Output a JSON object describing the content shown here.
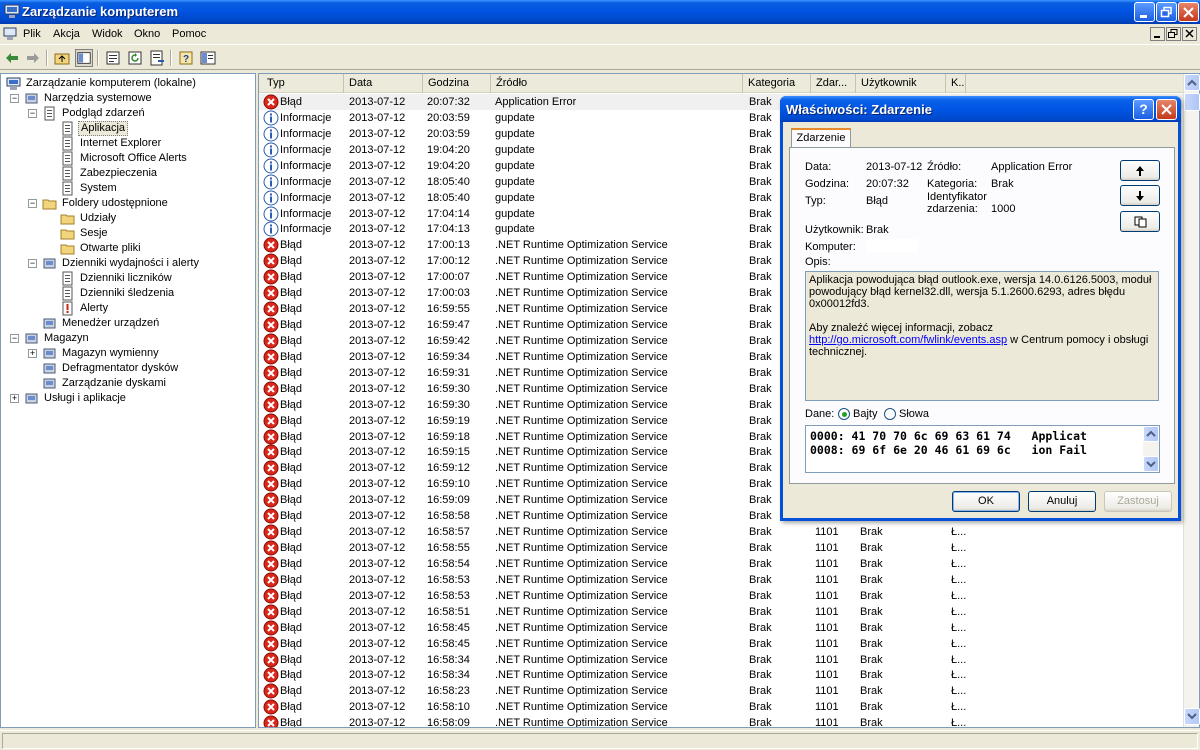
{
  "window": {
    "title": "Zarządzanie komputerem"
  },
  "menu": {
    "items": [
      "Plik",
      "Akcja",
      "Widok",
      "Okno",
      "Pomoc"
    ]
  },
  "tree": {
    "nodes": [
      {
        "label": "Zarządzanie komputerem (lokalne)",
        "icon": "computer-management-icon",
        "level": 0,
        "expander": ""
      },
      {
        "label": "Narzędzia systemowe",
        "icon": "system-tools-icon",
        "level": 1,
        "expander": "-"
      },
      {
        "label": "Podgląd zdarzeń",
        "icon": "event-viewer-icon",
        "level": 2,
        "expander": "-"
      },
      {
        "label": "Aplikacja",
        "icon": "log-icon",
        "level": 3,
        "expander": "",
        "selected": true
      },
      {
        "label": "Internet Explorer",
        "icon": "log-icon",
        "level": 3,
        "expander": ""
      },
      {
        "label": "Microsoft Office Alerts",
        "icon": "log-icon",
        "level": 3,
        "expander": ""
      },
      {
        "label": "Zabezpieczenia",
        "icon": "log-icon",
        "level": 3,
        "expander": ""
      },
      {
        "label": "System",
        "icon": "log-icon",
        "level": 3,
        "expander": ""
      },
      {
        "label": "Foldery udostępnione",
        "icon": "shared-folder-icon",
        "level": 2,
        "expander": "-"
      },
      {
        "label": "Udziały",
        "icon": "folder-icon",
        "level": 3,
        "expander": ""
      },
      {
        "label": "Sesje",
        "icon": "folder-icon",
        "level": 3,
        "expander": ""
      },
      {
        "label": "Otwarte pliki",
        "icon": "folder-icon",
        "level": 3,
        "expander": ""
      },
      {
        "label": "Dzienniki wydajności i alerty",
        "icon": "performance-icon",
        "level": 2,
        "expander": "-"
      },
      {
        "label": "Dzienniki liczników",
        "icon": "log-icon",
        "level": 3,
        "expander": ""
      },
      {
        "label": "Dzienniki śledzenia",
        "icon": "log-icon",
        "level": 3,
        "expander": ""
      },
      {
        "label": "Alerty",
        "icon": "alert-icon",
        "level": 3,
        "expander": ""
      },
      {
        "label": "Menedżer urządzeń",
        "icon": "device-manager-icon",
        "level": 2,
        "expander": ""
      },
      {
        "label": "Magazyn",
        "icon": "storage-icon",
        "level": 1,
        "expander": "-"
      },
      {
        "label": "Magazyn wymienny",
        "icon": "removable-storage-icon",
        "level": 2,
        "expander": "+"
      },
      {
        "label": "Defragmentator dysków",
        "icon": "defrag-icon",
        "level": 2,
        "expander": ""
      },
      {
        "label": "Zarządzanie dyskami",
        "icon": "disk-management-icon",
        "level": 2,
        "expander": ""
      },
      {
        "label": "Usługi i aplikacje",
        "icon": "services-icon",
        "level": 1,
        "expander": "+"
      }
    ]
  },
  "list": {
    "columns": [
      "Typ",
      "Data",
      "Godzina",
      "Źródło",
      "Kategoria",
      "Zdar...",
      "Użytkownik",
      "K..."
    ],
    "rows": [
      {
        "type": "err",
        "typ": "Błąd",
        "date": "2013-07-12",
        "time": "20:07:32",
        "source": "Application Error",
        "cat": "Brak",
        "ev": "",
        "user": "",
        "k": ""
      },
      {
        "type": "inf",
        "typ": "Informacje",
        "date": "2013-07-12",
        "time": "20:03:59",
        "source": "gupdate",
        "cat": "Brak",
        "ev": "",
        "user": "",
        "k": ""
      },
      {
        "type": "inf",
        "typ": "Informacje",
        "date": "2013-07-12",
        "time": "20:03:59",
        "source": "gupdate",
        "cat": "Brak",
        "ev": "",
        "user": "",
        "k": ""
      },
      {
        "type": "inf",
        "typ": "Informacje",
        "date": "2013-07-12",
        "time": "19:04:20",
        "source": "gupdate",
        "cat": "Brak",
        "ev": "",
        "user": "",
        "k": ""
      },
      {
        "type": "inf",
        "typ": "Informacje",
        "date": "2013-07-12",
        "time": "19:04:20",
        "source": "gupdate",
        "cat": "Brak",
        "ev": "",
        "user": "",
        "k": ""
      },
      {
        "type": "inf",
        "typ": "Informacje",
        "date": "2013-07-12",
        "time": "18:05:40",
        "source": "gupdate",
        "cat": "Brak",
        "ev": "",
        "user": "",
        "k": ""
      },
      {
        "type": "inf",
        "typ": "Informacje",
        "date": "2013-07-12",
        "time": "18:05:40",
        "source": "gupdate",
        "cat": "Brak",
        "ev": "",
        "user": "",
        "k": ""
      },
      {
        "type": "inf",
        "typ": "Informacje",
        "date": "2013-07-12",
        "time": "17:04:14",
        "source": "gupdate",
        "cat": "Brak",
        "ev": "",
        "user": "",
        "k": ""
      },
      {
        "type": "inf",
        "typ": "Informacje",
        "date": "2013-07-12",
        "time": "17:04:13",
        "source": "gupdate",
        "cat": "Brak",
        "ev": "",
        "user": "",
        "k": ""
      },
      {
        "type": "err",
        "typ": "Błąd",
        "date": "2013-07-12",
        "time": "17:00:13",
        "source": ".NET Runtime Optimization Service",
        "cat": "Brak",
        "ev": "",
        "user": "",
        "k": ""
      },
      {
        "type": "err",
        "typ": "Błąd",
        "date": "2013-07-12",
        "time": "17:00:12",
        "source": ".NET Runtime Optimization Service",
        "cat": "Brak",
        "ev": "",
        "user": "",
        "k": ""
      },
      {
        "type": "err",
        "typ": "Błąd",
        "date": "2013-07-12",
        "time": "17:00:07",
        "source": ".NET Runtime Optimization Service",
        "cat": "Brak",
        "ev": "",
        "user": "",
        "k": ""
      },
      {
        "type": "err",
        "typ": "Błąd",
        "date": "2013-07-12",
        "time": "17:00:03",
        "source": ".NET Runtime Optimization Service",
        "cat": "Brak",
        "ev": "",
        "user": "",
        "k": ""
      },
      {
        "type": "err",
        "typ": "Błąd",
        "date": "2013-07-12",
        "time": "16:59:55",
        "source": ".NET Runtime Optimization Service",
        "cat": "Brak",
        "ev": "",
        "user": "",
        "k": ""
      },
      {
        "type": "err",
        "typ": "Błąd",
        "date": "2013-07-12",
        "time": "16:59:47",
        "source": ".NET Runtime Optimization Service",
        "cat": "Brak",
        "ev": "",
        "user": "",
        "k": ""
      },
      {
        "type": "err",
        "typ": "Błąd",
        "date": "2013-07-12",
        "time": "16:59:42",
        "source": ".NET Runtime Optimization Service",
        "cat": "Brak",
        "ev": "",
        "user": "",
        "k": ""
      },
      {
        "type": "err",
        "typ": "Błąd",
        "date": "2013-07-12",
        "time": "16:59:34",
        "source": ".NET Runtime Optimization Service",
        "cat": "Brak",
        "ev": "",
        "user": "",
        "k": ""
      },
      {
        "type": "err",
        "typ": "Błąd",
        "date": "2013-07-12",
        "time": "16:59:31",
        "source": ".NET Runtime Optimization Service",
        "cat": "Brak",
        "ev": "",
        "user": "",
        "k": ""
      },
      {
        "type": "err",
        "typ": "Błąd",
        "date": "2013-07-12",
        "time": "16:59:30",
        "source": ".NET Runtime Optimization Service",
        "cat": "Brak",
        "ev": "",
        "user": "",
        "k": ""
      },
      {
        "type": "err",
        "typ": "Błąd",
        "date": "2013-07-12",
        "time": "16:59:30",
        "source": ".NET Runtime Optimization Service",
        "cat": "Brak",
        "ev": "",
        "user": "",
        "k": ""
      },
      {
        "type": "err",
        "typ": "Błąd",
        "date": "2013-07-12",
        "time": "16:59:19",
        "source": ".NET Runtime Optimization Service",
        "cat": "Brak",
        "ev": "",
        "user": "",
        "k": ""
      },
      {
        "type": "err",
        "typ": "Błąd",
        "date": "2013-07-12",
        "time": "16:59:18",
        "source": ".NET Runtime Optimization Service",
        "cat": "Brak",
        "ev": "",
        "user": "",
        "k": ""
      },
      {
        "type": "err",
        "typ": "Błąd",
        "date": "2013-07-12",
        "time": "16:59:15",
        "source": ".NET Runtime Optimization Service",
        "cat": "Brak",
        "ev": "",
        "user": "",
        "k": ""
      },
      {
        "type": "err",
        "typ": "Błąd",
        "date": "2013-07-12",
        "time": "16:59:12",
        "source": ".NET Runtime Optimization Service",
        "cat": "Brak",
        "ev": "",
        "user": "",
        "k": ""
      },
      {
        "type": "err",
        "typ": "Błąd",
        "date": "2013-07-12",
        "time": "16:59:10",
        "source": ".NET Runtime Optimization Service",
        "cat": "Brak",
        "ev": "",
        "user": "",
        "k": ""
      },
      {
        "type": "err",
        "typ": "Błąd",
        "date": "2013-07-12",
        "time": "16:59:09",
        "source": ".NET Runtime Optimization Service",
        "cat": "Brak",
        "ev": "",
        "user": "",
        "k": ""
      },
      {
        "type": "err",
        "typ": "Błąd",
        "date": "2013-07-12",
        "time": "16:58:58",
        "source": ".NET Runtime Optimization Service",
        "cat": "Brak",
        "ev": "",
        "user": "",
        "k": ""
      },
      {
        "type": "err",
        "typ": "Błąd",
        "date": "2013-07-12",
        "time": "16:58:57",
        "source": ".NET Runtime Optimization Service",
        "cat": "Brak",
        "ev": "1101",
        "user": "Brak",
        "k": "Ł..."
      },
      {
        "type": "err",
        "typ": "Błąd",
        "date": "2013-07-12",
        "time": "16:58:55",
        "source": ".NET Runtime Optimization Service",
        "cat": "Brak",
        "ev": "1101",
        "user": "Brak",
        "k": "Ł..."
      },
      {
        "type": "err",
        "typ": "Błąd",
        "date": "2013-07-12",
        "time": "16:58:54",
        "source": ".NET Runtime Optimization Service",
        "cat": "Brak",
        "ev": "1101",
        "user": "Brak",
        "k": "Ł..."
      },
      {
        "type": "err",
        "typ": "Błąd",
        "date": "2013-07-12",
        "time": "16:58:53",
        "source": ".NET Runtime Optimization Service",
        "cat": "Brak",
        "ev": "1101",
        "user": "Brak",
        "k": "Ł..."
      },
      {
        "type": "err",
        "typ": "Błąd",
        "date": "2013-07-12",
        "time": "16:58:53",
        "source": ".NET Runtime Optimization Service",
        "cat": "Brak",
        "ev": "1101",
        "user": "Brak",
        "k": "Ł..."
      },
      {
        "type": "err",
        "typ": "Błąd",
        "date": "2013-07-12",
        "time": "16:58:51",
        "source": ".NET Runtime Optimization Service",
        "cat": "Brak",
        "ev": "1101",
        "user": "Brak",
        "k": "Ł..."
      },
      {
        "type": "err",
        "typ": "Błąd",
        "date": "2013-07-12",
        "time": "16:58:45",
        "source": ".NET Runtime Optimization Service",
        "cat": "Brak",
        "ev": "1101",
        "user": "Brak",
        "k": "Ł..."
      },
      {
        "type": "err",
        "typ": "Błąd",
        "date": "2013-07-12",
        "time": "16:58:45",
        "source": ".NET Runtime Optimization Service",
        "cat": "Brak",
        "ev": "1101",
        "user": "Brak",
        "k": "Ł..."
      },
      {
        "type": "err",
        "typ": "Błąd",
        "date": "2013-07-12",
        "time": "16:58:34",
        "source": ".NET Runtime Optimization Service",
        "cat": "Brak",
        "ev": "1101",
        "user": "Brak",
        "k": "Ł..."
      },
      {
        "type": "err",
        "typ": "Błąd",
        "date": "2013-07-12",
        "time": "16:58:34",
        "source": ".NET Runtime Optimization Service",
        "cat": "Brak",
        "ev": "1101",
        "user": "Brak",
        "k": "Ł..."
      },
      {
        "type": "err",
        "typ": "Błąd",
        "date": "2013-07-12",
        "time": "16:58:23",
        "source": ".NET Runtime Optimization Service",
        "cat": "Brak",
        "ev": "1101",
        "user": "Brak",
        "k": "Ł..."
      },
      {
        "type": "err",
        "typ": "Błąd",
        "date": "2013-07-12",
        "time": "16:58:10",
        "source": ".NET Runtime Optimization Service",
        "cat": "Brak",
        "ev": "1101",
        "user": "Brak",
        "k": "Ł..."
      },
      {
        "type": "err",
        "typ": "Błąd",
        "date": "2013-07-12",
        "time": "16:58:09",
        "source": ".NET Runtime Optimization Service",
        "cat": "Brak",
        "ev": "1101",
        "user": "Brak",
        "k": "Ł..."
      }
    ]
  },
  "dialog": {
    "title": "Właściwości: Zdarzenie",
    "tab": "Zdarzenie",
    "date_label": "Data:",
    "date": "2013-07-12",
    "source_label": "Źródło:",
    "source": "Application Error",
    "time_label": "Godzina:",
    "time": "20:07:32",
    "category_label": "Kategoria:",
    "category": "Brak",
    "type_label": "Typ:",
    "type": "Błąd",
    "id_label_1": "Identyfikator",
    "id_label_2": "zdarzenia:",
    "id": "1000",
    "user_label": "Użytkownik:",
    "user": "Brak",
    "computer_label": "Komputer:",
    "description_label": "Opis:",
    "description_1": "Aplikacja powodująca błąd outlook.exe, wersja 14.0.6126.5003, moduł powodujący błąd kernel32.dll, wersja 5.1.2600.6293, adres błędu 0x00012fd3.",
    "description_2": "Aby znaleźć więcej informacji, zobacz",
    "description_link": "http://go.microsoft.com/fwlink/events.asp",
    "description_3": " w Centrum pomocy i obsługi technicznej.",
    "data_label": "Dane:",
    "bytes_label": "Bajty",
    "words_label": "Słowa",
    "hex_lines": [
      "0000: 41 70 70 6c 69 63 61 74   Applicat",
      "0008: 69 6f 6e 20 46 61 69 6c   ion Fail"
    ],
    "ok": "OK",
    "cancel": "Anuluj",
    "apply": "Zastosuj"
  }
}
